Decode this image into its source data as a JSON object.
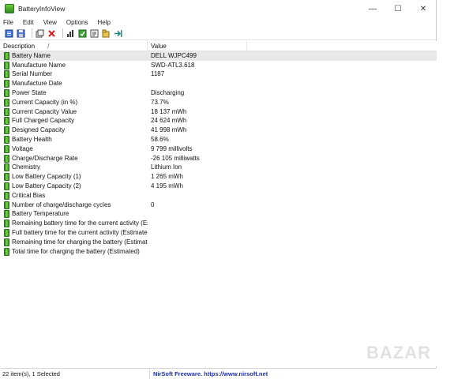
{
  "window": {
    "title": "BatteryInfoView"
  },
  "window_controls": {
    "minimize": "—",
    "maximize": "☐",
    "close": "✕"
  },
  "menu": [
    "File",
    "Edit",
    "View",
    "Options",
    "Help"
  ],
  "toolbar": [
    "properties-icon",
    "save-icon",
    "copy-icon",
    "delete-icon",
    "chart-icon",
    "refresh-icon",
    "report-icon",
    "export-icon",
    "exit-icon"
  ],
  "columns": {
    "description": "Description",
    "sort_indicator": "/",
    "value": "Value"
  },
  "rows": [
    {
      "label": "Battery Name",
      "value": "DELL WJPC499",
      "selected": true
    },
    {
      "label": "Manufacture Name",
      "value": "SWD-ATL3.618"
    },
    {
      "label": "Serial Number",
      "value": "1187"
    },
    {
      "label": "Manufacture Date",
      "value": ""
    },
    {
      "label": "Power State",
      "value": "Discharging"
    },
    {
      "label": "Current Capacity (in %)",
      "value": "73.7%"
    },
    {
      "label": "Current Capacity Value",
      "value": "18 137 mWh"
    },
    {
      "label": "Full Charged Capacity",
      "value": "24 624 mWh"
    },
    {
      "label": "Designed Capacity",
      "value": "41 998 mWh"
    },
    {
      "label": "Battery Health",
      "value": "58.6%"
    },
    {
      "label": "Voltage",
      "value": "9 799 millivolts"
    },
    {
      "label": "Charge/Discharge Rate",
      "value": "-26 105 milliwatts"
    },
    {
      "label": "Chemistry",
      "value": "Lithium Ion"
    },
    {
      "label": "Low Battery Capacity (1)",
      "value": "1 265 mWh"
    },
    {
      "label": "Low Battery Capacity (2)",
      "value": "4 195 mWh"
    },
    {
      "label": "Critical Bias",
      "value": ""
    },
    {
      "label": "Number of charge/discharge cycles",
      "value": "0"
    },
    {
      "label": "Battery Temperature",
      "value": ""
    },
    {
      "label": "Remaining battery time for the current activity (Est...",
      "value": ""
    },
    {
      "label": "Full battery time for the current activity (Estimated)",
      "value": ""
    },
    {
      "label": "Remaining time for charging the battery (Estimated)",
      "value": ""
    },
    {
      "label": "Total  time for charging the battery (Estimated)",
      "value": ""
    }
  ],
  "status": {
    "items": "22 item(s), 1 Selected",
    "credit": "NirSoft Freeware. https://www.nirsoft.net"
  },
  "watermark": "BAZAR",
  "colors": {
    "selection": "#e8e8e8",
    "credit_link": "#1a2fb0",
    "battery_icon": "#2e8a1e"
  }
}
